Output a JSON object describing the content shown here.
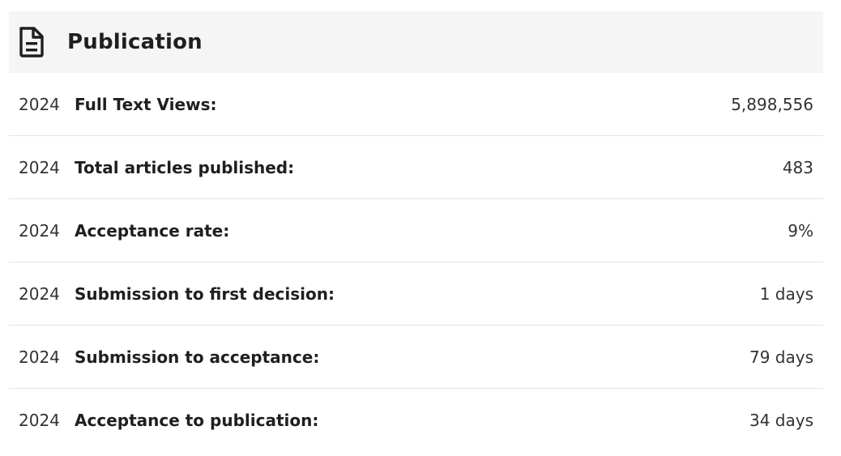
{
  "section": {
    "title": "Publication",
    "icon": "document-icon"
  },
  "rows": [
    {
      "year": "2024",
      "label": "Full Text Views:",
      "value": "5,898,556"
    },
    {
      "year": "2024",
      "label": "Total articles published:",
      "value": "483"
    },
    {
      "year": "2024",
      "label": "Acceptance rate:",
      "value": "9%"
    },
    {
      "year": "2024",
      "label": "Submission to first decision:",
      "value": "1 days"
    },
    {
      "year": "2024",
      "label": "Submission to acceptance:",
      "value": "79 days"
    },
    {
      "year": "2024",
      "label": "Acceptance to publication:",
      "value": "34 days"
    }
  ]
}
